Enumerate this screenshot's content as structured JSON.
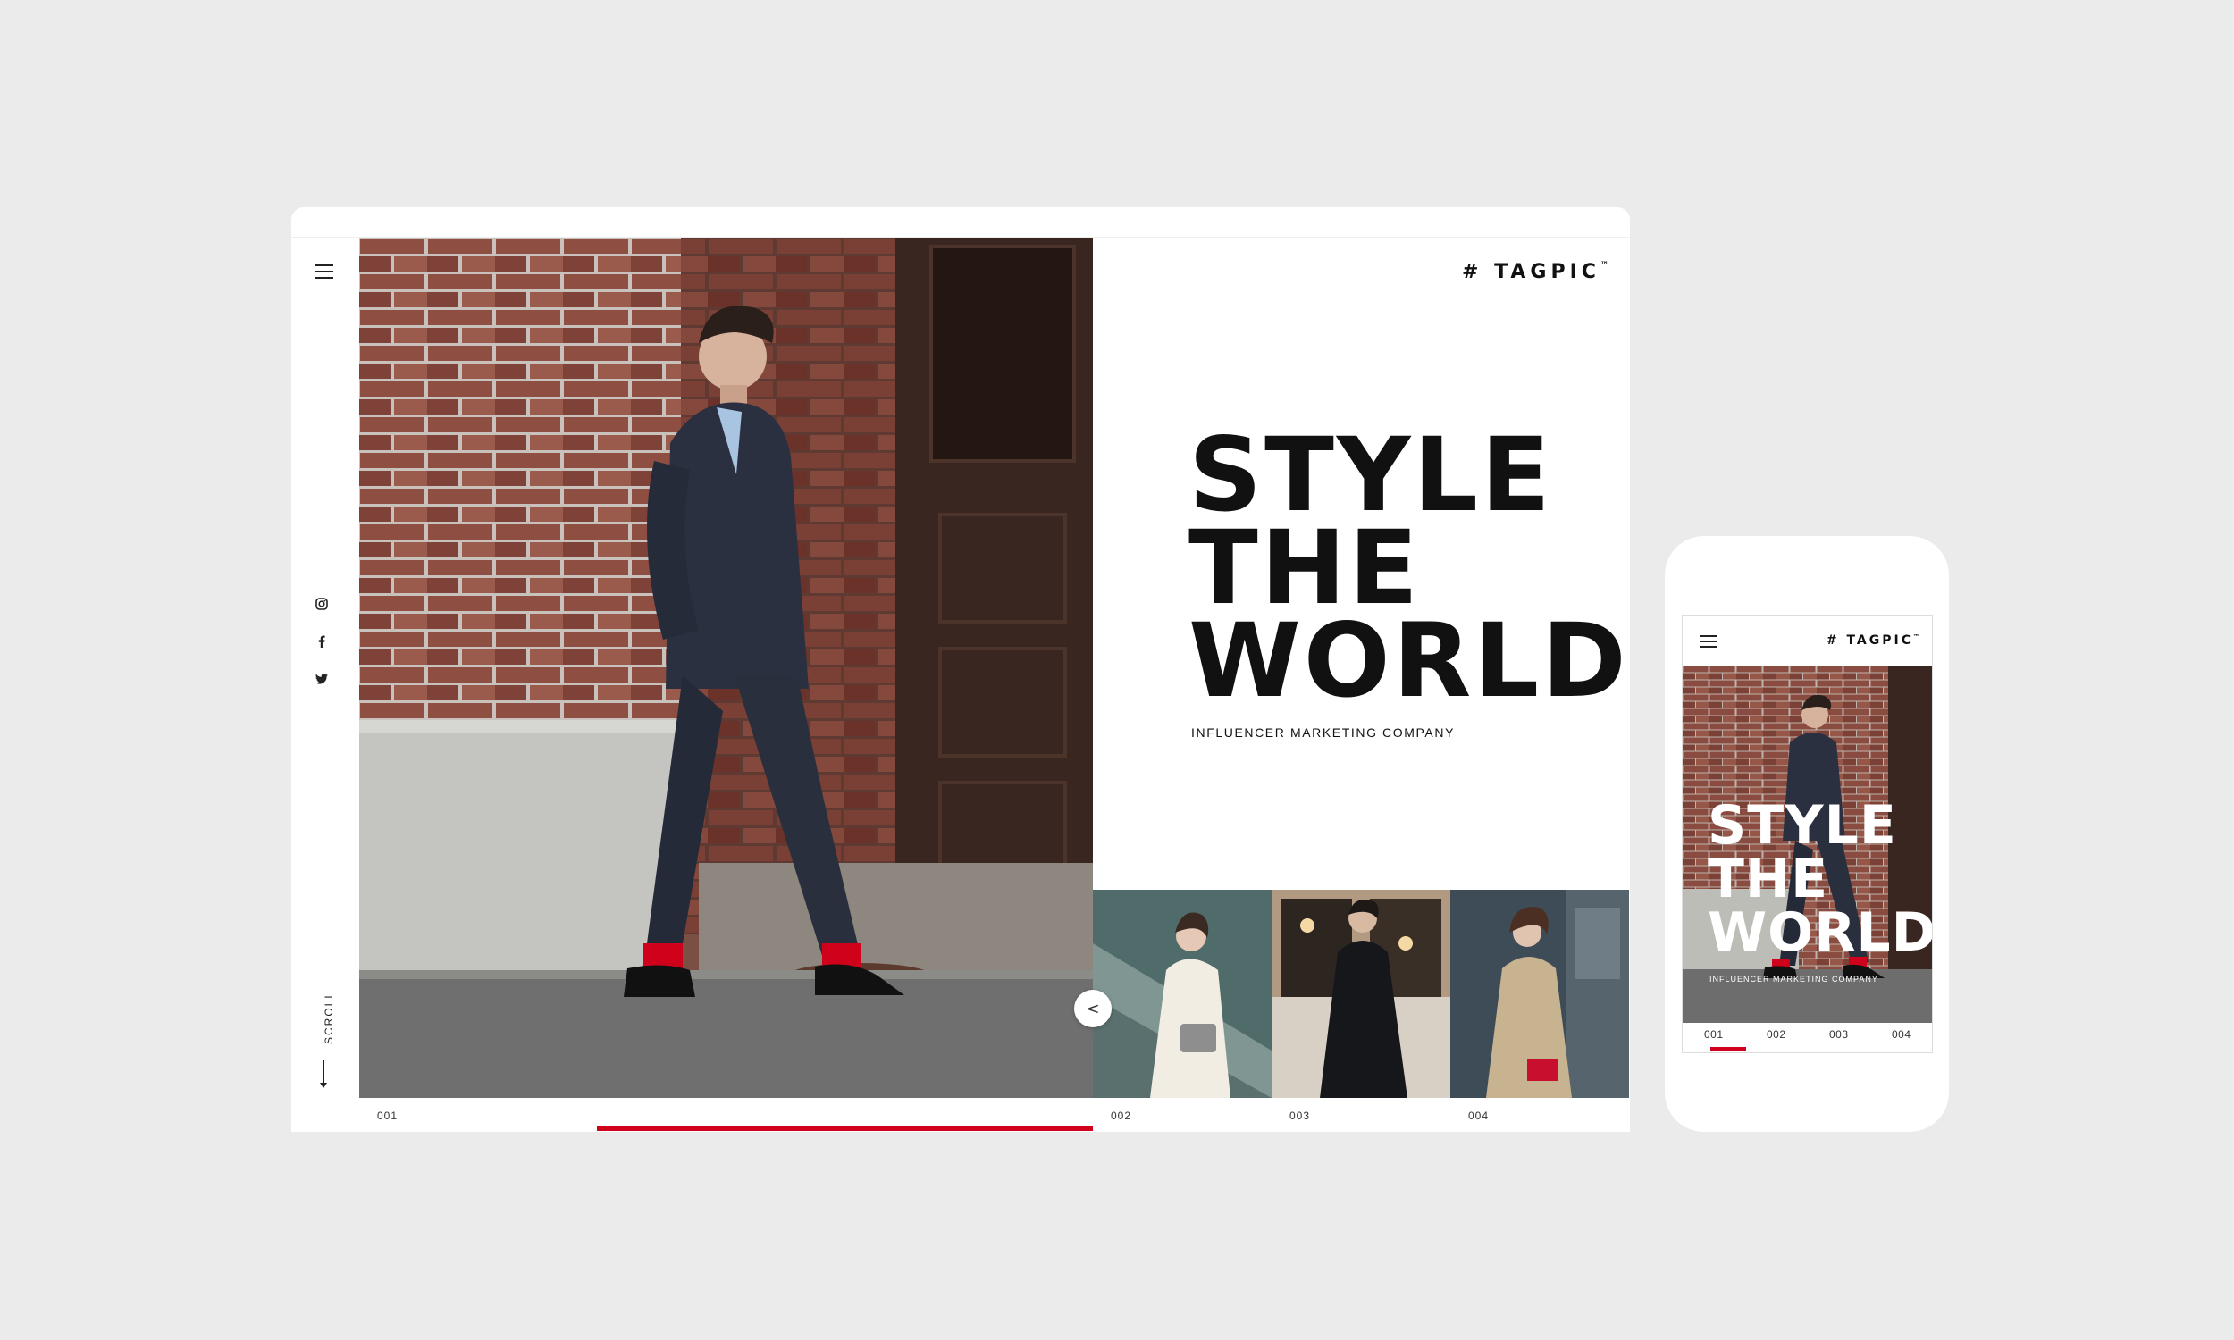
{
  "desktop": {
    "logo": "# TAGPIC",
    "logo_tm": "™",
    "headline": [
      "STYLE",
      "THE",
      "WORLD"
    ],
    "tagline": "INFLUENCER MARKETING COMPANY",
    "scroll_label": "SCROLL",
    "prev_label": "<",
    "slides": [
      "001",
      "002",
      "003",
      "004"
    ],
    "social_icons": [
      "instagram-icon",
      "facebook-icon",
      "twitter-icon"
    ],
    "accent_color": "#d0021b"
  },
  "mobile": {
    "logo": "# TAGPIC",
    "logo_tm": "™",
    "headline": [
      "STYLE",
      "THE",
      "WORLD"
    ],
    "tagline": "INFLUENCER MARKETING COMPANY",
    "slides": [
      "001",
      "002",
      "003",
      "004"
    ]
  }
}
